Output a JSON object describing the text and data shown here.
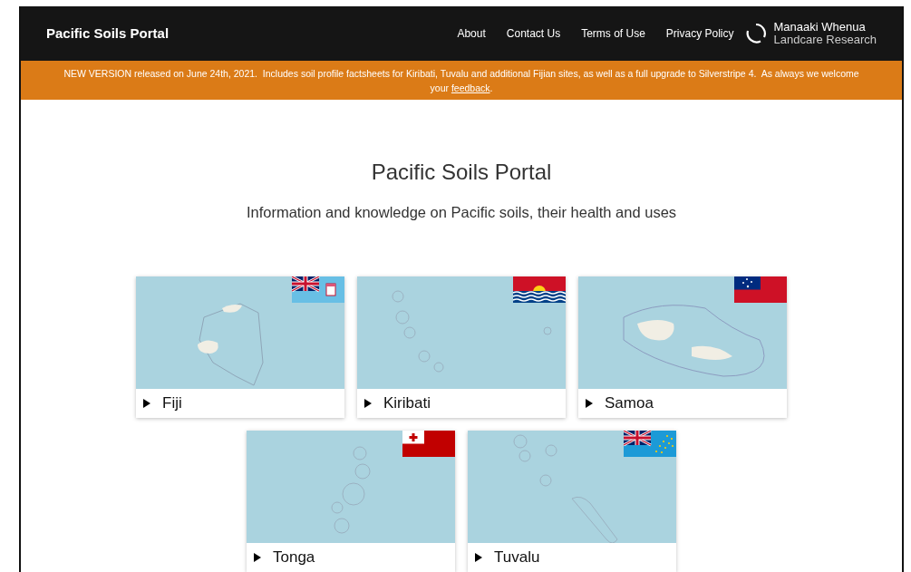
{
  "header": {
    "site_title": "Pacific Soils Portal",
    "nav": [
      "About",
      "Contact Us",
      "Terms of Use",
      "Privacy Policy"
    ],
    "logo": {
      "line_1": "Manaaki Whenua",
      "line_2": "Landcare Research"
    }
  },
  "banner": {
    "text": "NEW VERSION released on June 24th, 2021.  Includes soil profile factsheets for Kiribati, Tuvalu and additional Fijian sites, as well as a full upgrade to Silverstripe 4.  As always we welcome your ",
    "link": "feedback",
    "end": "."
  },
  "hero": {
    "title": "Pacific Soils Portal",
    "subtitle": "Information and knowledge on Pacific soils, their health and uses"
  },
  "countries": [
    {
      "name": "Fiji",
      "kind": "fiji",
      "expanded": false
    },
    {
      "name": "Kiribati",
      "kind": "kiribati",
      "expanded": false
    },
    {
      "name": "Samoa",
      "kind": "samoa",
      "expanded": false
    },
    {
      "name": "Tonga",
      "kind": "tonga",
      "expanded": false
    },
    {
      "name": "Tuvalu",
      "kind": "tuvalu",
      "expanded": false
    }
  ]
}
